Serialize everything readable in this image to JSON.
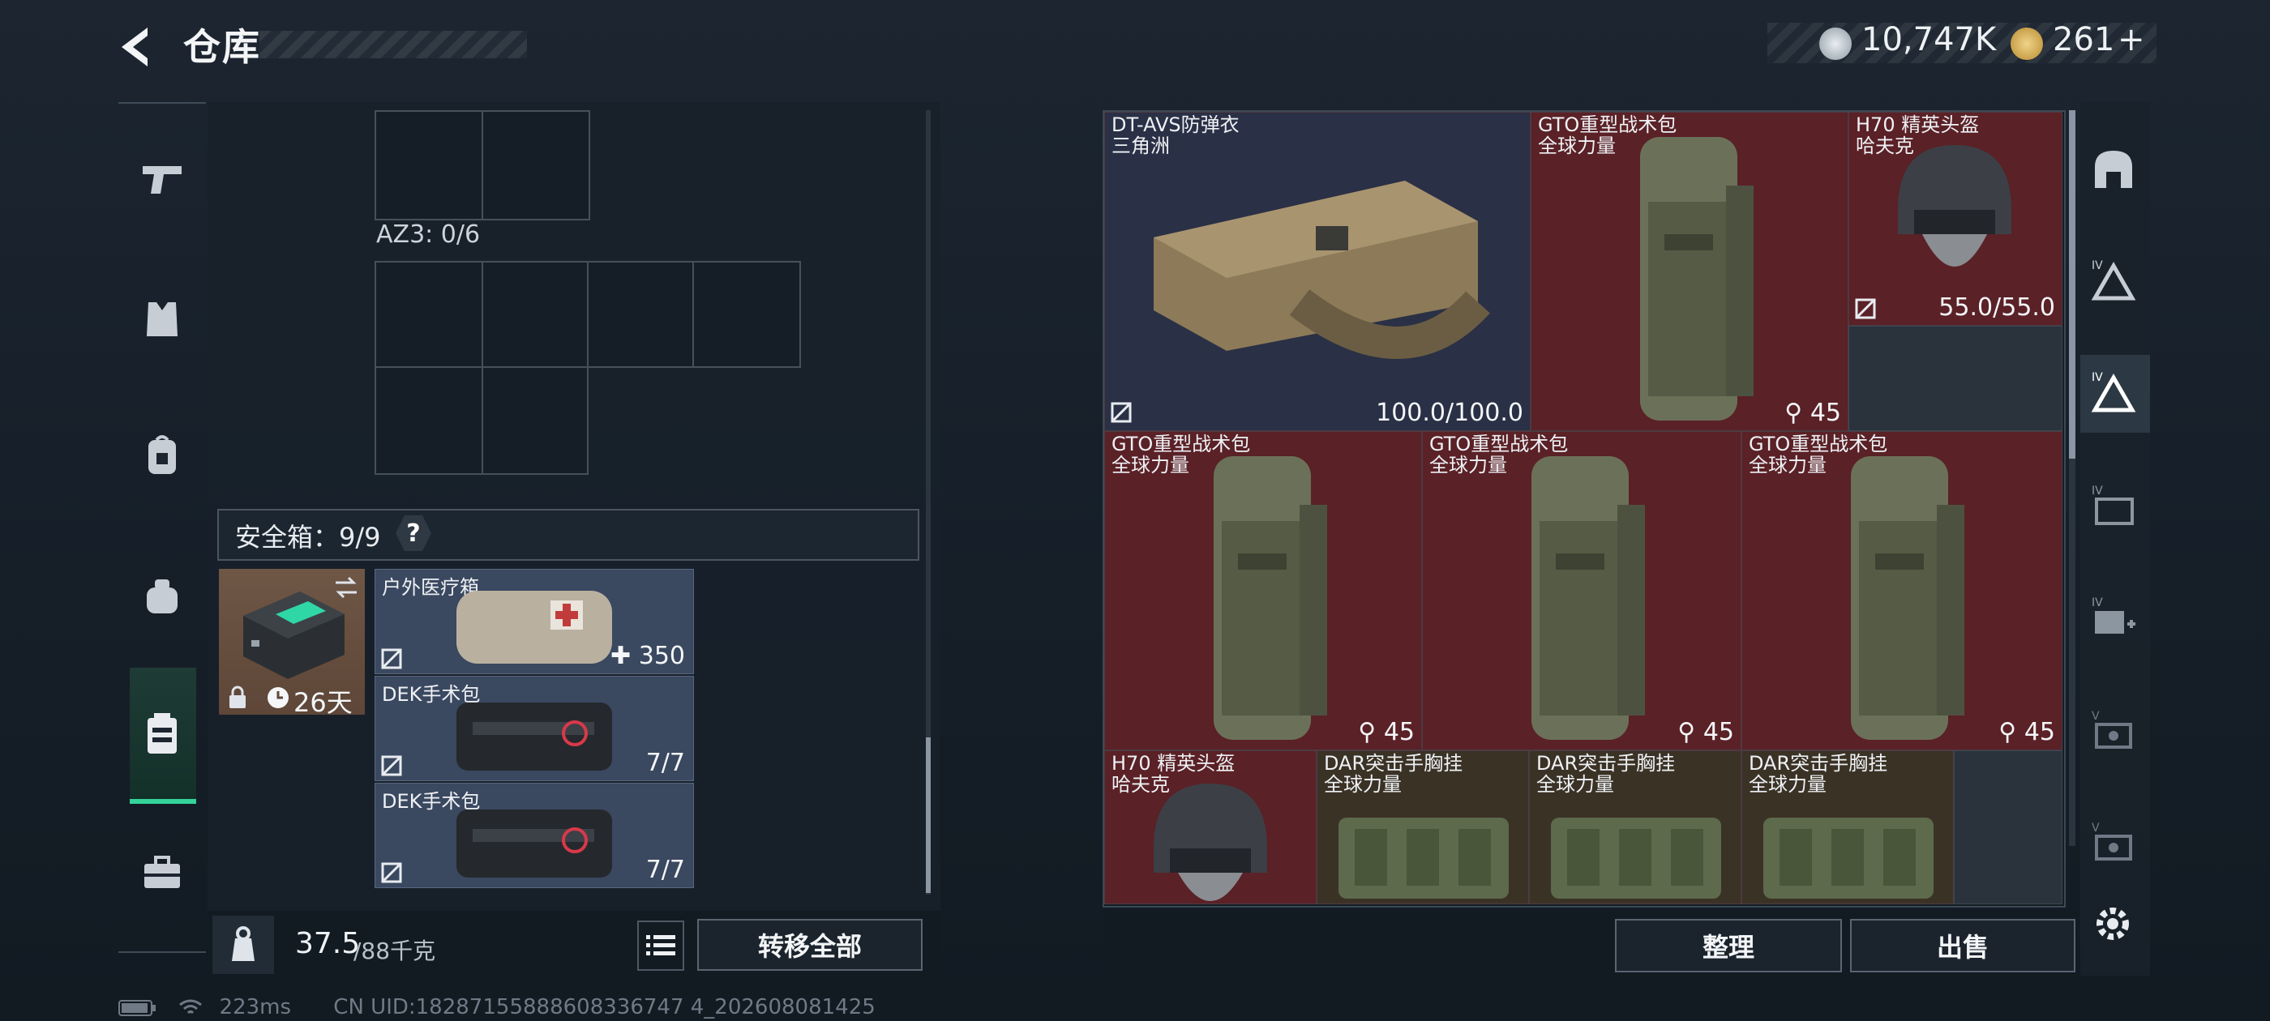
{
  "header": {
    "title": "仓库",
    "currency": {
      "silver": "10,747K",
      "gold": "261",
      "gold_plus": "+"
    }
  },
  "sidebar": {
    "items": [
      {
        "icon": "gun-icon"
      },
      {
        "icon": "vest-icon"
      },
      {
        "icon": "backpack-icon"
      },
      {
        "icon": "bag-icon"
      },
      {
        "icon": "safe-case-icon",
        "active": true
      },
      {
        "icon": "briefcase-icon"
      }
    ]
  },
  "container": {
    "az3_label": "AZ3: 0/6"
  },
  "safe_box": {
    "label": "安全箱：9/9",
    "help": "?",
    "case_time": "26天",
    "items": [
      {
        "name": "户外医疗箱",
        "value": "350"
      },
      {
        "name": "DEK手术包",
        "value": "7/7"
      },
      {
        "name": "DEK手术包",
        "value": "7/7"
      }
    ]
  },
  "footer": {
    "weight_current": "37.5",
    "weight_rest": "/88千克",
    "transfer_all": "转移全部"
  },
  "status": {
    "ping": "223ms",
    "uid": "CN UID:18287155888608336747 4_202608081425"
  },
  "stash": {
    "items": [
      {
        "name": "DT-AVS防弹衣",
        "sub": "三角洲",
        "value": "100.0/100.0"
      },
      {
        "name": "GTO重型战术包",
        "sub": "全球力量",
        "value": "45"
      },
      {
        "name": "H70 精英头盔",
        "sub": "哈夫克",
        "value": "55.0/55.0"
      },
      {
        "name": "GTO重型战术包",
        "sub": "全球力量",
        "value": "45"
      },
      {
        "name": "GTO重型战术包",
        "sub": "全球力量",
        "value": "45"
      },
      {
        "name": "GTO重型战术包",
        "sub": "全球力量",
        "value": "45"
      },
      {
        "name": "H70 精英头盔",
        "sub": "哈夫克"
      },
      {
        "name": "DAR突击手胸挂",
        "sub": "全球力量"
      },
      {
        "name": "DAR突击手胸挂",
        "sub": "全球力量"
      },
      {
        "name": "DAR突击手胸挂",
        "sub": "全球力量"
      }
    ],
    "sort": "整理",
    "sell": "出售"
  },
  "colors": {
    "accent": "#33d39a",
    "red_tile": "#5a2127",
    "blue_tile": "#2a3045",
    "brown_tile": "#5e4638"
  }
}
